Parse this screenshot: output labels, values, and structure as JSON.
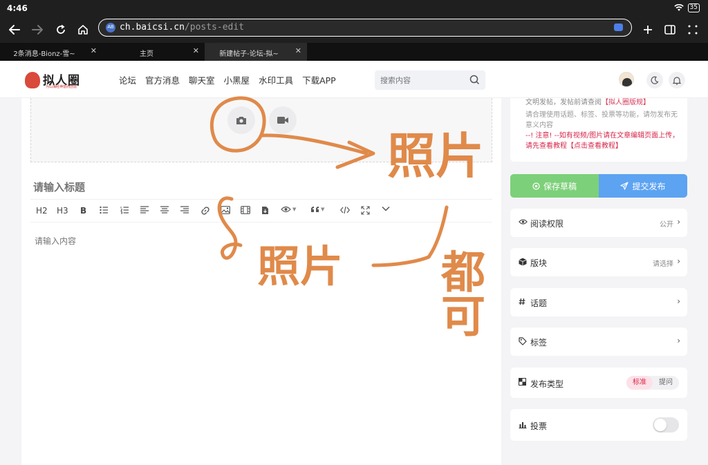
{
  "status": {
    "time": "4:46",
    "battery": "35"
  },
  "browser": {
    "url_host": "ch.baicsi.cn",
    "url_path": "/posts-edit",
    "site_icon": "AB",
    "tabs": [
      {
        "label": "2条消息-Bionz-雪~"
      },
      {
        "label": "主页"
      },
      {
        "label": "新建帖子-论坛-拟~"
      }
    ]
  },
  "site": {
    "logo_text": "拟人圈",
    "logo_sub": "为山海经神兽而创造",
    "nav": [
      "论坛",
      "官方消息",
      "聊天室",
      "小黑屋",
      "水印工具",
      "下载APP"
    ],
    "search_placeholder": "搜索内容"
  },
  "editor": {
    "title_placeholder": "请输入标题",
    "content_placeholder": "请输入内容",
    "toolbar": {
      "h2": "H2",
      "h3": "H3",
      "bold": "B"
    }
  },
  "sidebar": {
    "notice_line1_pre": "文明发帖，发帖前请查阅",
    "notice_line1_link": "【拟人圈版规】",
    "notice_line2": "请合理使用话题、标签、投票等功能，请勿发布无意义内容",
    "notice_line3": "--! 注意! --如有视频/图片请在文章编辑页面上传，请先查看教程【点击查看教程】",
    "save_draft": "保存草稿",
    "submit": "提交发布",
    "options": {
      "read_permission": {
        "label": "阅读权限",
        "value": "公开"
      },
      "board": {
        "label": "版块",
        "value": "请选择"
      },
      "topic": {
        "label": "话题"
      },
      "tags": {
        "label": "标签"
      },
      "post_type": {
        "label": "发布类型",
        "choices": [
          "标准",
          "提问"
        ]
      },
      "vote": {
        "label": "投票"
      }
    }
  },
  "annotations": {
    "photo_top": "照片",
    "photo_mid": "照片",
    "all": "都可"
  },
  "colors": {
    "accent_pink": "#d6284a",
    "draft_green": "#7dd07a",
    "submit_blue": "#5ca3f2",
    "scribble": "#e08a4a"
  }
}
